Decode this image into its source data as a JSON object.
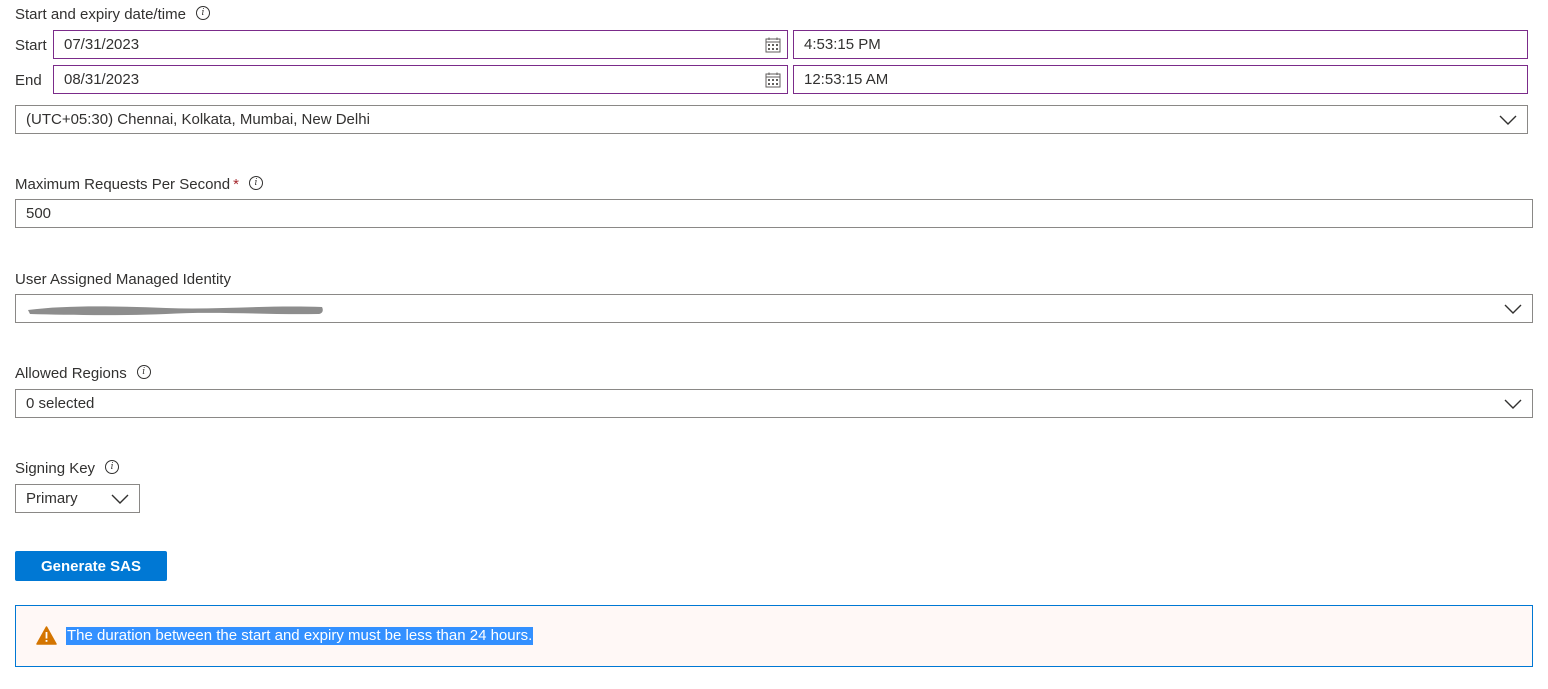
{
  "datetime": {
    "title": "Start and expiry date/time",
    "start_label": "Start",
    "start_date": "07/31/2023",
    "start_time": "4:53:15 PM",
    "end_label": "End",
    "end_date": "08/31/2023",
    "end_time": "12:53:15 AM",
    "timezone": "(UTC+05:30) Chennai, Kolkata, Mumbai, New Delhi"
  },
  "max_requests": {
    "label": "Maximum Requests Per Second",
    "required_mark": "*",
    "value": "500"
  },
  "managed_identity": {
    "label": "User Assigned Managed Identity",
    "value": ""
  },
  "allowed_regions": {
    "label": "Allowed Regions",
    "value": "0 selected"
  },
  "signing_key": {
    "label": "Signing Key",
    "value": "Primary"
  },
  "generate_button": "Generate SAS",
  "warning": {
    "message": "The duration between the start and expiry must be less than 24 hours."
  },
  "icons": {
    "info": "info-icon",
    "calendar": "calendar-icon",
    "dropdown": "chevron-down-icon",
    "warning": "warning-icon"
  },
  "colors": {
    "accent": "#0078d4",
    "focus_border": "#7b2b8a",
    "warning_icon": "#d47500",
    "warning_bg": "#fff8f6",
    "required": "#a4262c"
  }
}
